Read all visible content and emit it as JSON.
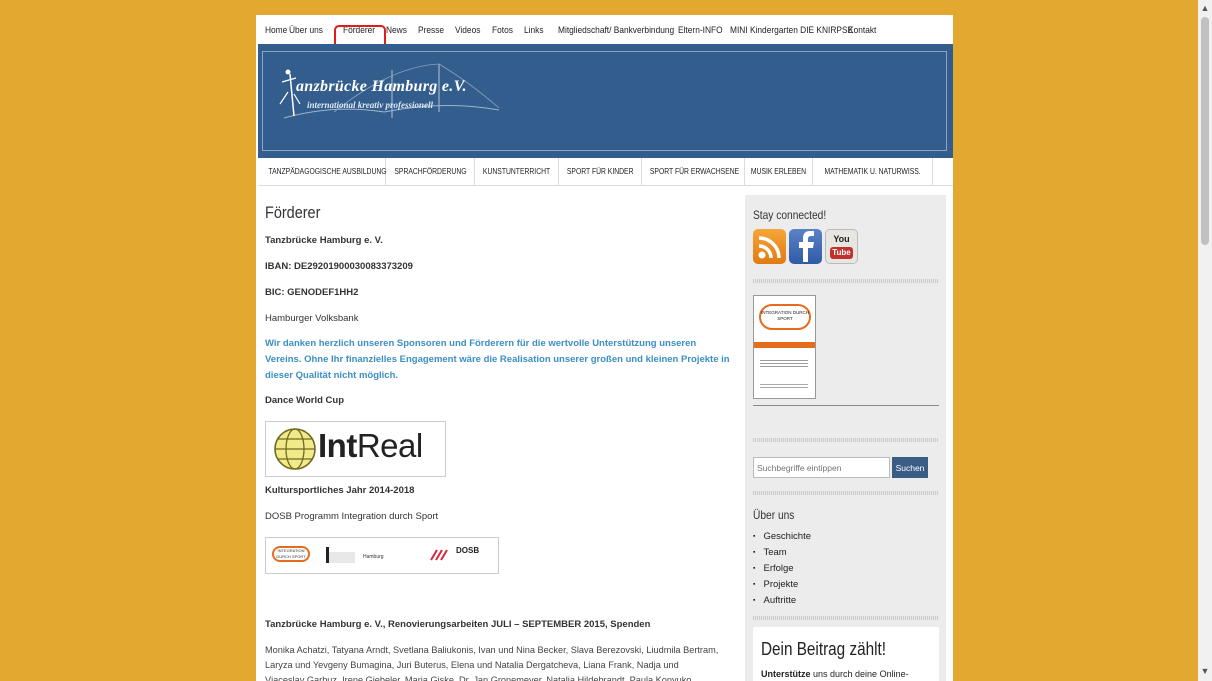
{
  "top_nav": {
    "items": [
      "Home",
      "Über uns",
      "Förderer",
      "News",
      "Presse",
      "Videos",
      "Fotos",
      "Links",
      "Mitgliedschaft/ Bankverbindung",
      "Eltern-INFO",
      "MINI Kindergarten DIE KNIRPSE",
      "Kontakt"
    ],
    "active": "Förderer"
  },
  "banner": {
    "title": "anzbrücke Hamburg e.V.",
    "tagline": "international kreativ professionell"
  },
  "category_nav": [
    "TANZPÄDAGOGISCHE AUSBILDUNG",
    "SPRACHFÖRDERUNG",
    "KUNSTUNTERRICHT",
    "SPORT FÜR KINDER",
    "SPORT FÜR ERWACHSENE",
    "MUSIK ERLEBEN",
    "MATHEMATIK U. NATURWISS."
  ],
  "main": {
    "page_title": "Förderer",
    "org": "Tanzbrücke Hamburg e. V.",
    "iban": "IBAN: DE29201900030083373209",
    "bic": "BIC: GENODEF1HH2",
    "bank": "Hamburger Volksbank",
    "thanks": "Wir danken herzlich unseren Sponsoren und Förderern für die wertvolle Unterstützung unseren Vereins. Ohne Ihr finanzielles Engagement wäre die Realisation unserer großen und kleinen Projekte in dieser Qualität nicht möglich.",
    "dance_world_cup": "Dance World Cup",
    "intreal_bold": "Int",
    "intreal_light": "Real",
    "kultur_year": "Kultursportliches Jahr 2014-2018",
    "dosb_program": "DOSB Programm Integration durch Sport",
    "dosb_logo_text": "DOSB",
    "integration_logo_text": "INTEGRATION DURCH SPORT",
    "hamburg_logo_text": "Hamburg",
    "renovation_heading": "Tanzbrücke Hamburg e. V., Renovierungsarbeiten JULI – SEPTEMBER 2015, Spenden",
    "donors": "Monika Achatzi, Tatyana Arndt, Svetlana Baliukonis, Ivan und Nina Becker, Slava Berezovski, Liudmila Bertram, Laryza und Yevgeny Bumagina, Juri Buterus, Elena und Natalia Dergatcheva, Liana Frank, Nadja und Vjaceslav Garbuz, Irene Giebeler, Maria Giske, Dr. Jan Gronemeyer, Natalia Hildebrandt, Paula Konyuko, Svetlana Kishigina, Ellen König, Oliver Kriege, Eduard und Margareta Kunzel, Olga und"
  },
  "sidebar": {
    "stay_connected": "Stay connected!",
    "social_icons": [
      "rss-icon",
      "facebook-icon",
      "youtube-icon"
    ],
    "youtube_label_top": "You",
    "youtube_label_bottom": "Tube",
    "poster_heading": "INTEGRATION DURCH SPORT",
    "search_placeholder": "Suchbegriffe eintippen",
    "search_button": "Suchen",
    "about_heading": "Über uns",
    "about_items": [
      "Geschichte",
      "Team",
      "Erfolge",
      "Projekte",
      "Auftritte"
    ],
    "beitrag_heading": "Dein Beitrag zählt!",
    "beitrag_text_bold": "Unterstütze",
    "beitrag_text_rest": " uns durch deine Online-"
  },
  "colors": {
    "background": "#e3a830",
    "banner": "#325d8d",
    "link_blue": "#3b8fc4",
    "highlight_red": "#e21c1c"
  }
}
